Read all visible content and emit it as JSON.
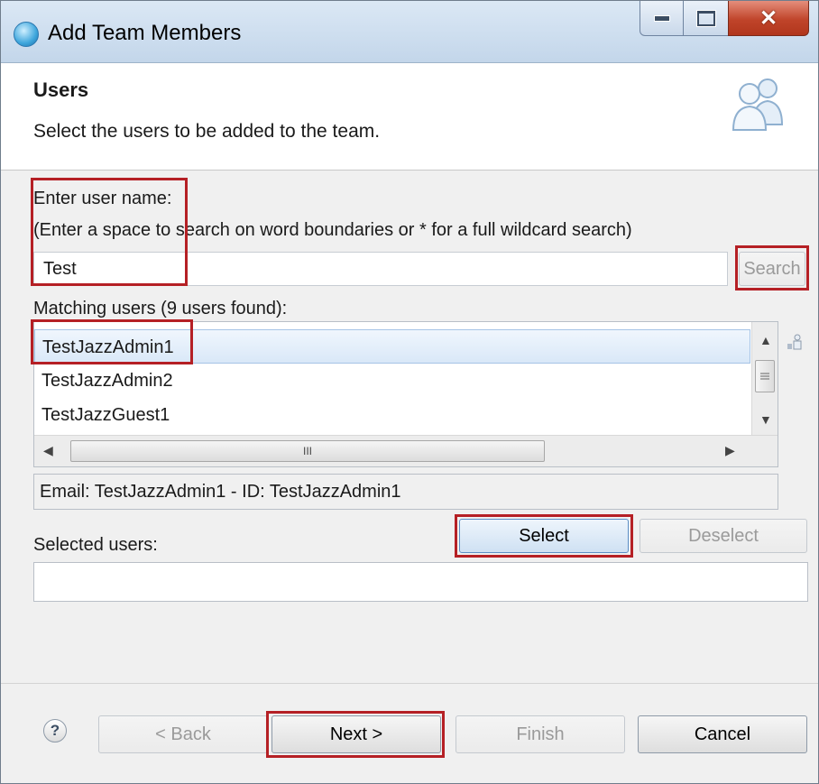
{
  "window": {
    "title": "Add Team Members"
  },
  "header": {
    "title": "Users",
    "subtitle": "Select the users to be added to the team.",
    "icon": "users-icon"
  },
  "search": {
    "label": "Enter user name:",
    "hint": "(Enter a space to search on word boundaries or * for a full wildcard search)",
    "value": "Test",
    "button_label": "Search"
  },
  "matching": {
    "label": "Matching users (9 users found):",
    "items": [
      {
        "label": "TestJazzAdmin1",
        "selected": true
      },
      {
        "label": "TestJazzAdmin2",
        "selected": false
      },
      {
        "label": "TestJazzGuest1",
        "selected": false
      }
    ],
    "hscroll_thumb_glyph": "III"
  },
  "details": {
    "text": "Email: TestJazzAdmin1 - ID: TestJazzAdmin1"
  },
  "selection": {
    "label": "Selected users:",
    "select_label": "Select",
    "deselect_label": "Deselect"
  },
  "footer": {
    "help_glyph": "?",
    "back_label": "< Back",
    "next_label": "Next >",
    "finish_label": "Finish",
    "cancel_label": "Cancel"
  },
  "colors": {
    "highlight": "#b52025",
    "titlebar": "#c3d6ea",
    "close_button": "#c0442a"
  }
}
